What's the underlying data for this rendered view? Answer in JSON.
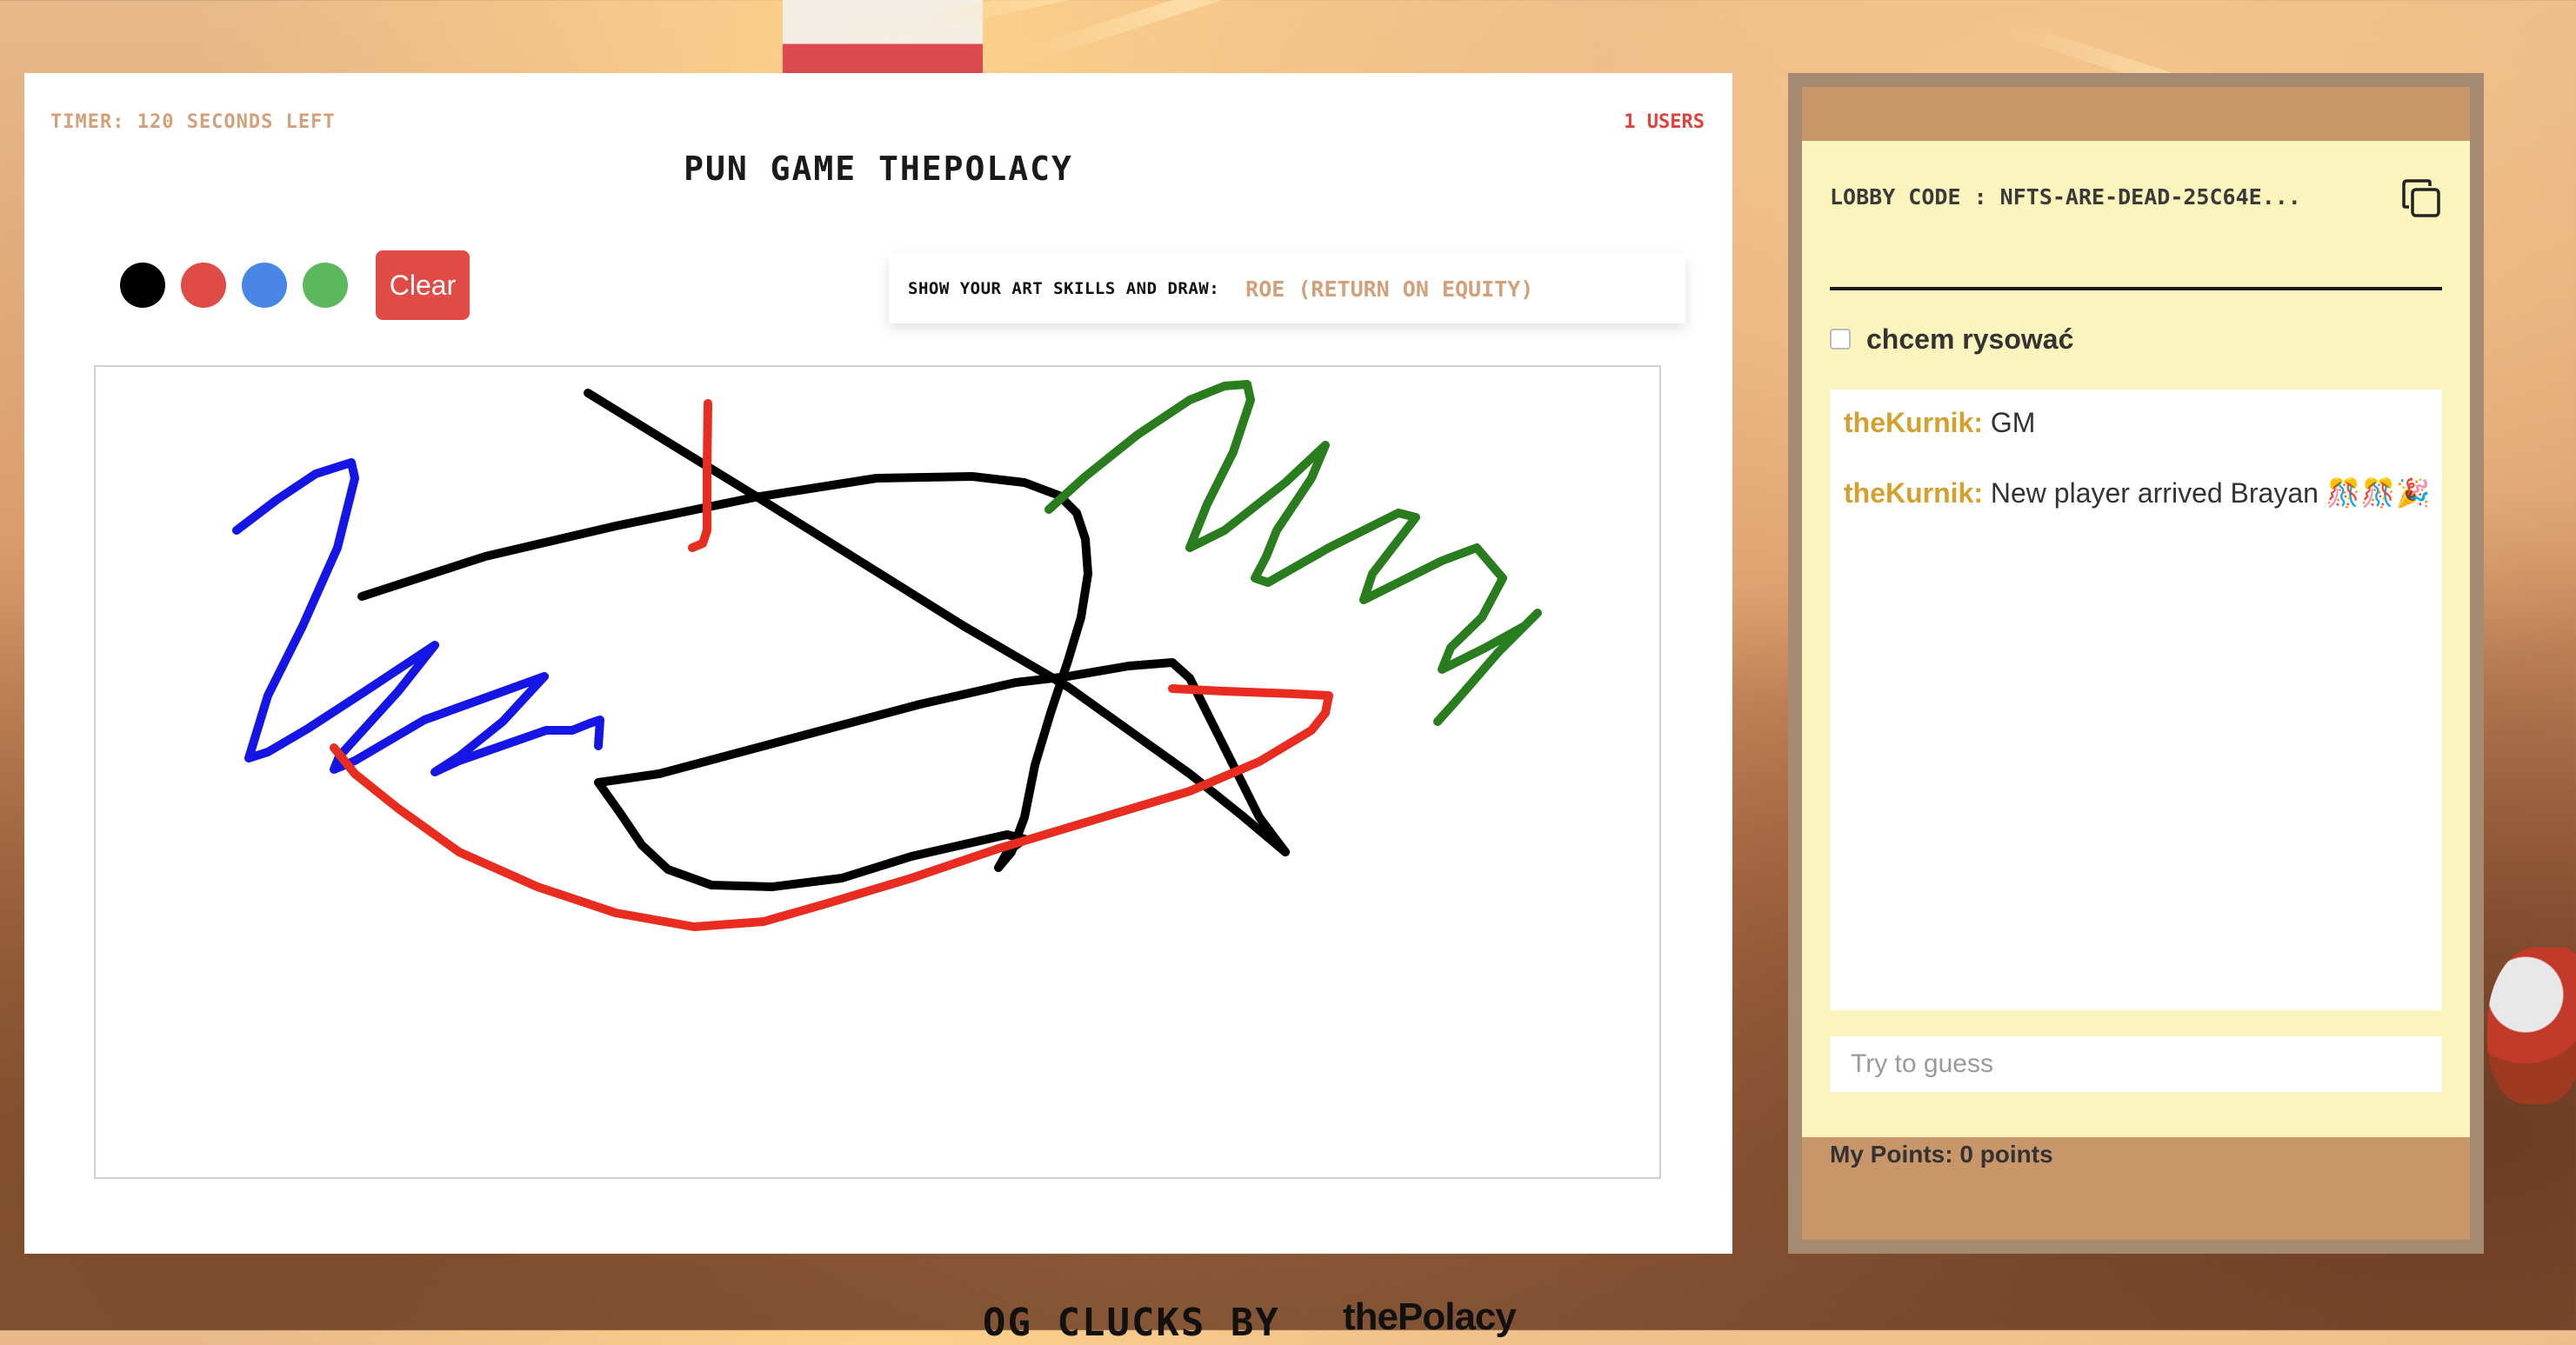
{
  "game": {
    "timer": "TIMER: 120 SECONDS LEFT",
    "users": "1 USERS",
    "title": "PUN GAME THEPOLACY",
    "colors": {
      "black": "#000000",
      "red": "#e04b45",
      "blue": "#4a86e8",
      "green": "#5cb85c",
      "accent": "#d4a07a"
    },
    "clear_label": "Clear",
    "prompt_label": "SHOW YOUR ART SKILLS AND DRAW:",
    "prompt_word": "ROE (RETURN ON EQUITY)"
  },
  "sidebar": {
    "lobby_code": "LOBBY CODE : NFTS-ARE-DEAD-25C64E...",
    "copy_icon": "copy-icon",
    "checkbox_label": "chcem rysować",
    "checkbox_checked": false,
    "messages": [
      {
        "author": "theKurnik:",
        "text": "GM"
      },
      {
        "author": "theKurnik:",
        "text": "New player arrived Brayan 🎊🎊🎉"
      }
    ],
    "guess_placeholder": "Try to guess",
    "points": "My Points: 0 points"
  },
  "footer": {
    "text": "OG CLUCKS BY",
    "logo": "thePolacy"
  }
}
